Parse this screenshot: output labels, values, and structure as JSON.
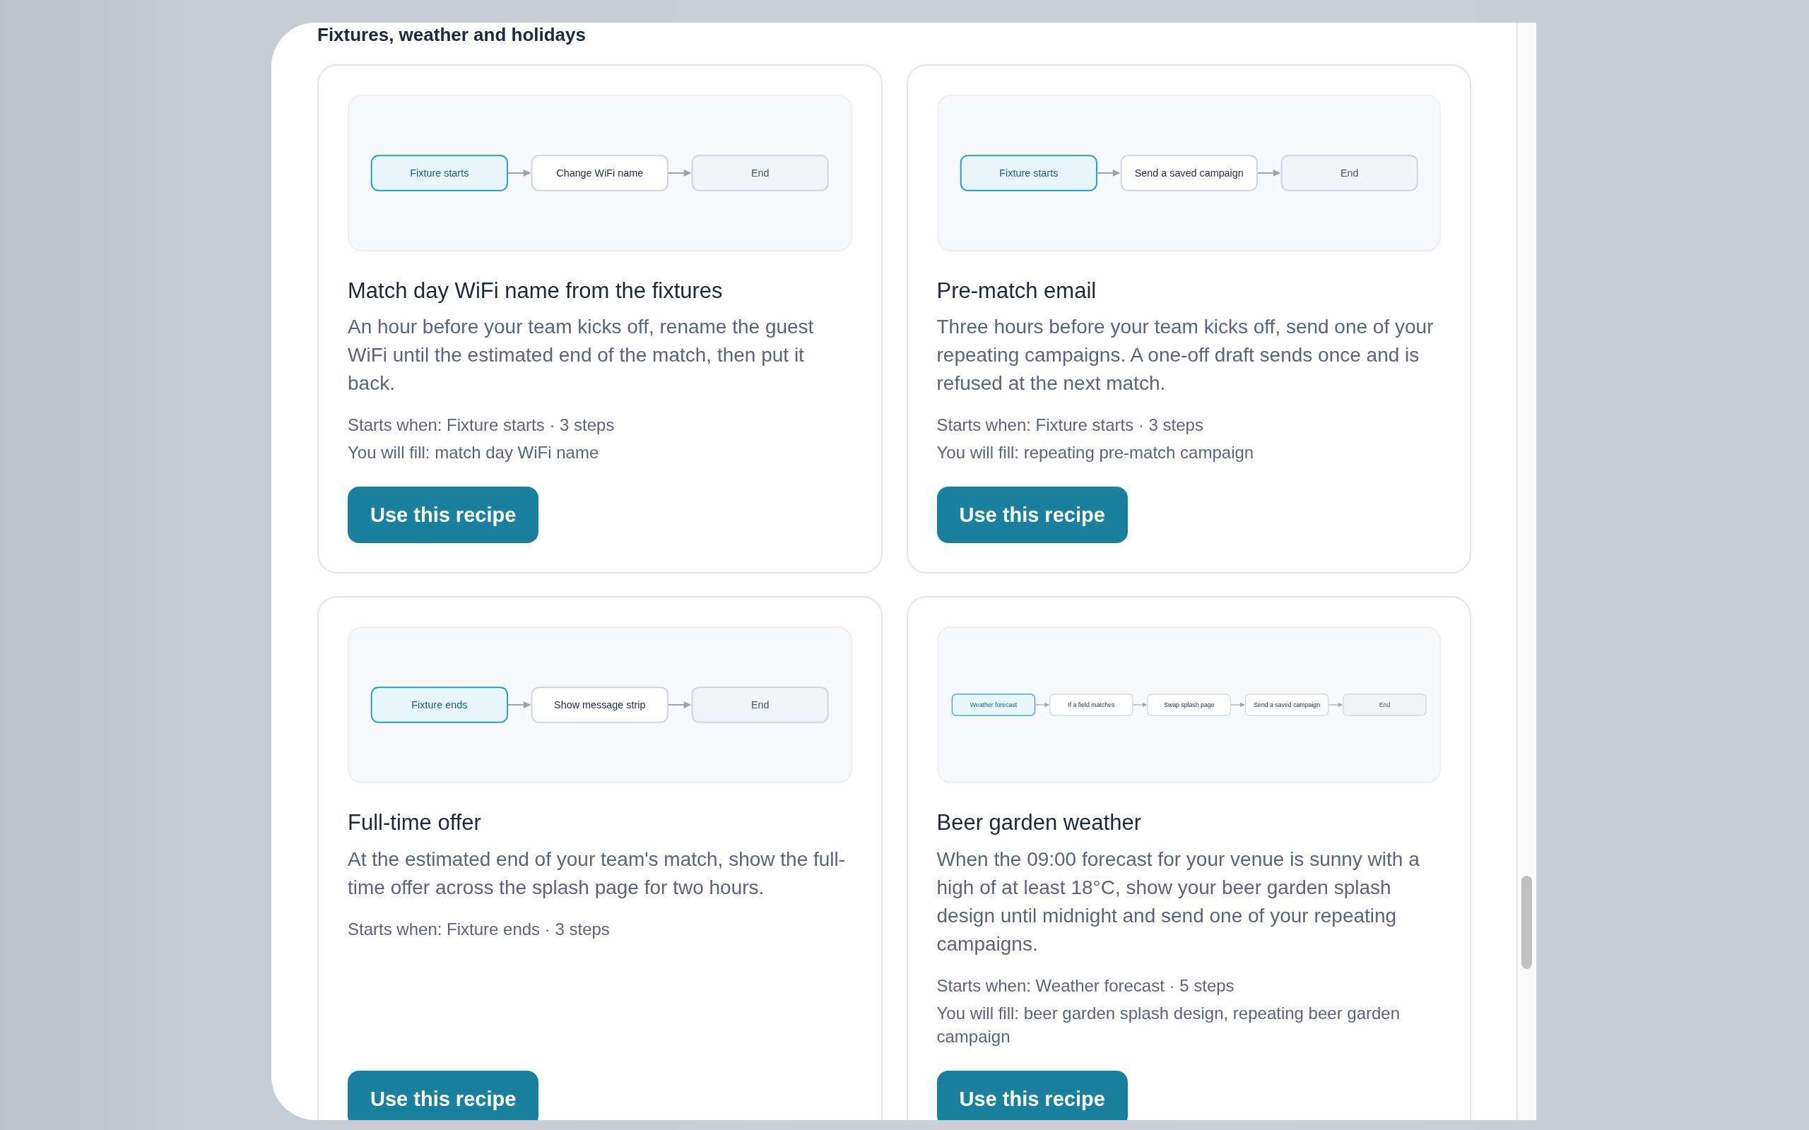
{
  "section": {
    "title": "Fixtures, weather and holidays",
    "recipes": [
      {
        "flow": [
          {
            "label": "Fixture starts",
            "kind": "trigger"
          },
          {
            "label": "Change WiFi name",
            "kind": "action"
          },
          {
            "label": "End",
            "kind": "end"
          }
        ],
        "title": "Match day WiFi name from the fixtures",
        "description": "An hour before your team kicks off, rename the guest WiFi until the estimated end of the match, then put it back.",
        "details": [
          "Starts when: Fixture starts · 3 steps",
          "You will fill: match day WiFi name"
        ],
        "button": "Use this recipe"
      },
      {
        "flow": [
          {
            "label": "Fixture starts",
            "kind": "trigger"
          },
          {
            "label": "Send a saved campaign",
            "kind": "action"
          },
          {
            "label": "End",
            "kind": "end"
          }
        ],
        "title": "Pre-match email",
        "description": "Three hours before your team kicks off, send one of your repeating campaigns. A one-off draft sends once and is refused at the next match.",
        "details": [
          "Starts when: Fixture starts · 3 steps",
          "You will fill: repeating pre-match campaign"
        ],
        "button": "Use this recipe"
      },
      {
        "flow": [
          {
            "label": "Fixture ends",
            "kind": "trigger"
          },
          {
            "label": "Show message strip",
            "kind": "action"
          },
          {
            "label": "End",
            "kind": "end"
          }
        ],
        "title": "Full-time offer",
        "description": "At the estimated end of your team's match, show the full-time offer across the splash page for two hours.",
        "details": [
          "Starts when: Fixture ends · 3 steps"
        ],
        "button": "Use this recipe"
      },
      {
        "flow": [
          {
            "label": "Weather forecast",
            "kind": "trigger"
          },
          {
            "label": "If a field matches",
            "kind": "action"
          },
          {
            "label": "Swap splash page",
            "kind": "action"
          },
          {
            "label": "Send a saved campaign",
            "kind": "action"
          },
          {
            "label": "End",
            "kind": "end"
          }
        ],
        "title": "Beer garden weather",
        "description": "When the 09:00 forecast for your venue is sunny with a high of at least 18°C, show your beer garden splash design until midnight and send one of your repeating campaigns.",
        "details": [
          "Starts when: Weather forecast · 5 steps",
          "You will fill: beer garden splash design, repeating beer garden campaign"
        ],
        "button": "Use this recipe"
      }
    ]
  }
}
